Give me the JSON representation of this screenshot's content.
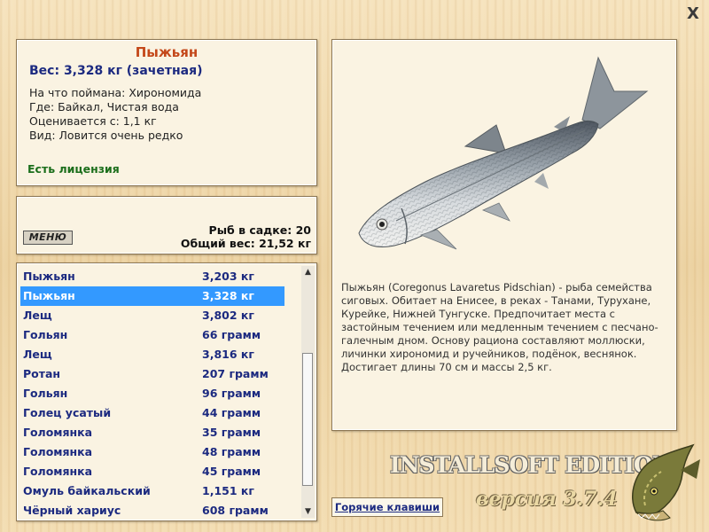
{
  "window": {
    "close_label": "X"
  },
  "info": {
    "title": "Пыжьян",
    "weight": "Вес: 3,328 кг (зачетная)",
    "caught_on": "На что поймана: Хирономида",
    "where": "Где: Байкал, Чистая вода",
    "valued_from": "Оценивается с: 1,1 кг",
    "kind": "Вид: Ловится очень редко",
    "license": "Есть лицензия"
  },
  "menu": {
    "button_label": "МЕНЮ",
    "cage_count": "Рыб в садке: 20",
    "total_weight": "Общий вес: 21,52 кг"
  },
  "catch_list": [
    {
      "name": "Пыжьян",
      "weight": "3,203 кг",
      "selected": false
    },
    {
      "name": "Пыжьян",
      "weight": "3,328 кг",
      "selected": true
    },
    {
      "name": "Лещ",
      "weight": "3,802 кг",
      "selected": false
    },
    {
      "name": "Гольян",
      "weight": "66 грамм",
      "selected": false
    },
    {
      "name": "Лещ",
      "weight": "3,816 кг",
      "selected": false
    },
    {
      "name": "Ротан",
      "weight": "207 грамм",
      "selected": false
    },
    {
      "name": "Гольян",
      "weight": "96 грамм",
      "selected": false
    },
    {
      "name": "Голец усатый",
      "weight": "44 грамм",
      "selected": false
    },
    {
      "name": "Голомянка",
      "weight": "35 грамм",
      "selected": false
    },
    {
      "name": "Голомянка",
      "weight": "48 грамм",
      "selected": false
    },
    {
      "name": "Голомянка",
      "weight": "45 грамм",
      "selected": false
    },
    {
      "name": "Омуль байкальский",
      "weight": "1,151 кг",
      "selected": false
    },
    {
      "name": "Чёрный хариус",
      "weight": "608 грамм",
      "selected": false
    }
  ],
  "description": "Пыжьян (Coregonus Lavaretus Pidschian) - рыба семейства сиговых. Обитает на Енисее, в реках - Танами, Турухане, Курейке, Нижней Тунгуске. Предпочитает места с застойным течением или медленным течением с песчано-галечным дном. Основу рациона составляют моллюски, личинки хирономид и ручейников, подёнок, веснянок. Достигает длины 70 см и массы 2,5 кг.",
  "hotkeys_label": "Горячие клавиши",
  "edition": {
    "title": "INSTALLSOFT EDITION",
    "version": "версия 3.7.4"
  },
  "colors": {
    "accent_title": "#c4481a",
    "list_text": "#1c2a80",
    "selection": "#3399ff",
    "license": "#1b6e1b"
  },
  "icons": {
    "close": "close-icon",
    "logo": "pike-logo-icon",
    "fish": "fish-image"
  }
}
